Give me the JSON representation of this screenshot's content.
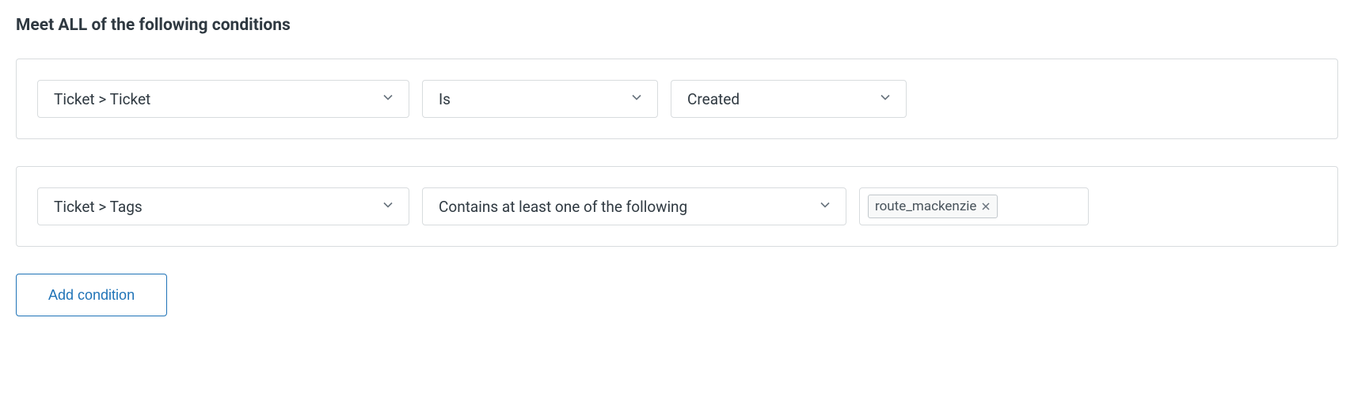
{
  "section": {
    "title": "Meet ALL of the following conditions"
  },
  "conditions": [
    {
      "field": "Ticket > Ticket",
      "operator": "Is",
      "value": "Created"
    },
    {
      "field": "Ticket > Tags",
      "operator": "Contains at least one of the following",
      "tags": [
        "route_mackenzie"
      ]
    }
  ],
  "buttons": {
    "add_condition": "Add condition"
  }
}
